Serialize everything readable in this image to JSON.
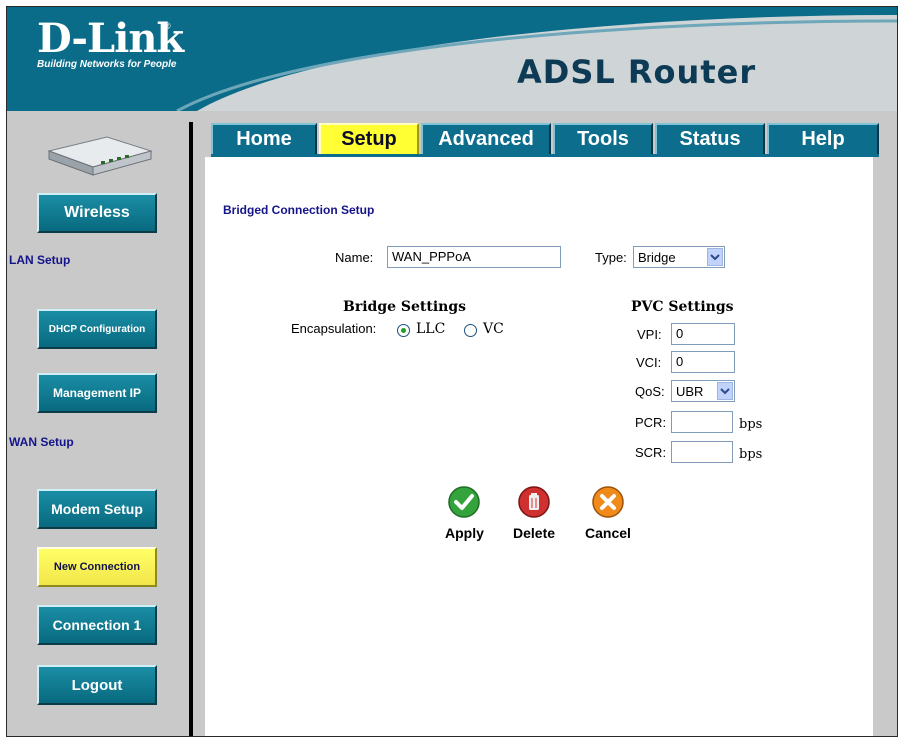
{
  "header": {
    "logo": "D-Link",
    "logo_reg": "®",
    "tagline": "Building Networks for People",
    "product": "ADSL Router"
  },
  "tabs": [
    {
      "label": "Home",
      "active": false
    },
    {
      "label": "Setup",
      "active": true
    },
    {
      "label": "Advanced",
      "active": false
    },
    {
      "label": "Tools",
      "active": false
    },
    {
      "label": "Status",
      "active": false
    },
    {
      "label": "Help",
      "active": false
    }
  ],
  "sidebar": {
    "wireless": "Wireless",
    "lan_setup": "LAN Setup",
    "dhcp": "DHCP Configuration",
    "management_ip": "Management IP",
    "wan_setup": "WAN Setup",
    "modem_setup": "Modem Setup",
    "new_connection": "New Connection",
    "connection1": "Connection 1",
    "logout": "Logout"
  },
  "form": {
    "title": "Bridged Connection Setup",
    "name_label": "Name:",
    "name_value": "WAN_PPPoA",
    "type_label": "Type:",
    "type_value": "Bridge",
    "bridge_heading": "Bridge Settings",
    "encap_label": "Encapsulation:",
    "encap_llc": "LLC",
    "encap_vc": "VC",
    "encap_selected": "LLC",
    "pvc_heading": "PVC Settings",
    "vpi_label": "VPI:",
    "vpi_value": "0",
    "vci_label": "VCI:",
    "vci_value": "0",
    "qos_label": "QoS:",
    "qos_value": "UBR",
    "pcr_label": "PCR:",
    "pcr_value": "",
    "pcr_unit": "bps",
    "scr_label": "SCR:",
    "scr_value": "",
    "scr_unit": "bps"
  },
  "actions": {
    "apply": "Apply",
    "delete": "Delete",
    "cancel": "Cancel"
  },
  "colors": {
    "header_blue": "#0b6c8a",
    "tab_blue": "#0c6d8c",
    "active_yellow": "#ffff33",
    "label_navy": "#14148a"
  },
  "icons": {
    "apply": "green-check-icon",
    "delete": "red-trash-icon",
    "cancel": "orange-x-icon",
    "device": "router-device-icon"
  }
}
